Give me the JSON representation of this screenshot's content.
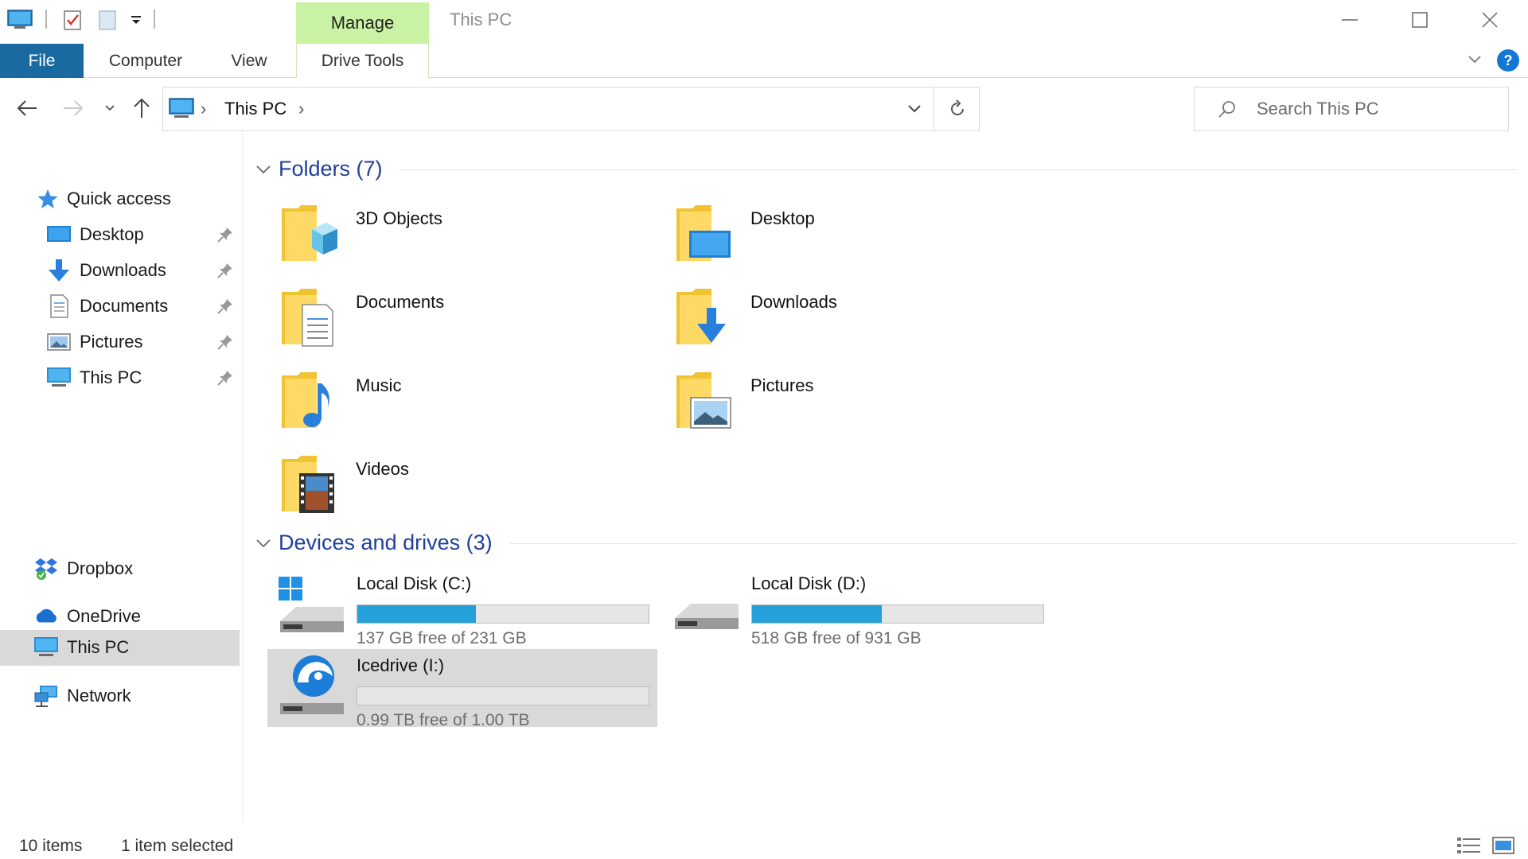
{
  "window": {
    "title": "This PC",
    "contextual_tab": "Manage",
    "accent": "#1a6aa1",
    "contextual_color": "#c9f2a4"
  },
  "ribbon": {
    "tabs": [
      "File",
      "Computer",
      "View",
      "Drive Tools"
    ]
  },
  "address": {
    "path": "This PC",
    "search_placeholder": "Search This PC"
  },
  "navpane": {
    "quick_access": "Quick access",
    "pinned": [
      {
        "label": "Desktop",
        "icon": "desktop-icon"
      },
      {
        "label": "Downloads",
        "icon": "downloads-icon"
      },
      {
        "label": "Documents",
        "icon": "documents-icon"
      },
      {
        "label": "Pictures",
        "icon": "pictures-icon"
      },
      {
        "label": "This PC",
        "icon": "this-pc-icon"
      }
    ],
    "roots": [
      {
        "label": "Dropbox",
        "icon": "dropbox-icon"
      },
      {
        "label": "OneDrive",
        "icon": "onedrive-icon"
      },
      {
        "label": "This PC",
        "icon": "this-pc-icon",
        "selected": true
      },
      {
        "label": "Network",
        "icon": "network-icon"
      }
    ]
  },
  "content": {
    "folders_header": "Folders (7)",
    "folders": [
      {
        "label": "3D Objects",
        "icon": "3d-objects-folder-icon"
      },
      {
        "label": "Desktop",
        "icon": "desktop-folder-icon"
      },
      {
        "label": "Documents",
        "icon": "documents-folder-icon"
      },
      {
        "label": "Downloads",
        "icon": "downloads-folder-icon"
      },
      {
        "label": "Music",
        "icon": "music-folder-icon"
      },
      {
        "label": "Pictures",
        "icon": "pictures-folder-icon"
      },
      {
        "label": "Videos",
        "icon": "videos-folder-icon"
      }
    ],
    "drives_header": "Devices and drives (3)",
    "drives": [
      {
        "label": "Local Disk (C:)",
        "free": "137 GB free of 231 GB",
        "used_fraction": 0.407,
        "icon": "windows-drive-icon"
      },
      {
        "label": "Local Disk (D:)",
        "free": "518 GB free of 931 GB",
        "used_fraction": 0.444,
        "icon": "hard-drive-icon"
      },
      {
        "label": "Icedrive (I:)",
        "free": "0.99 TB free of 1.00 TB",
        "used_fraction": 0.0,
        "icon": "icedrive-drive-icon",
        "selected": true
      }
    ]
  },
  "status": {
    "items": "10 items",
    "selected": "1 item selected"
  }
}
